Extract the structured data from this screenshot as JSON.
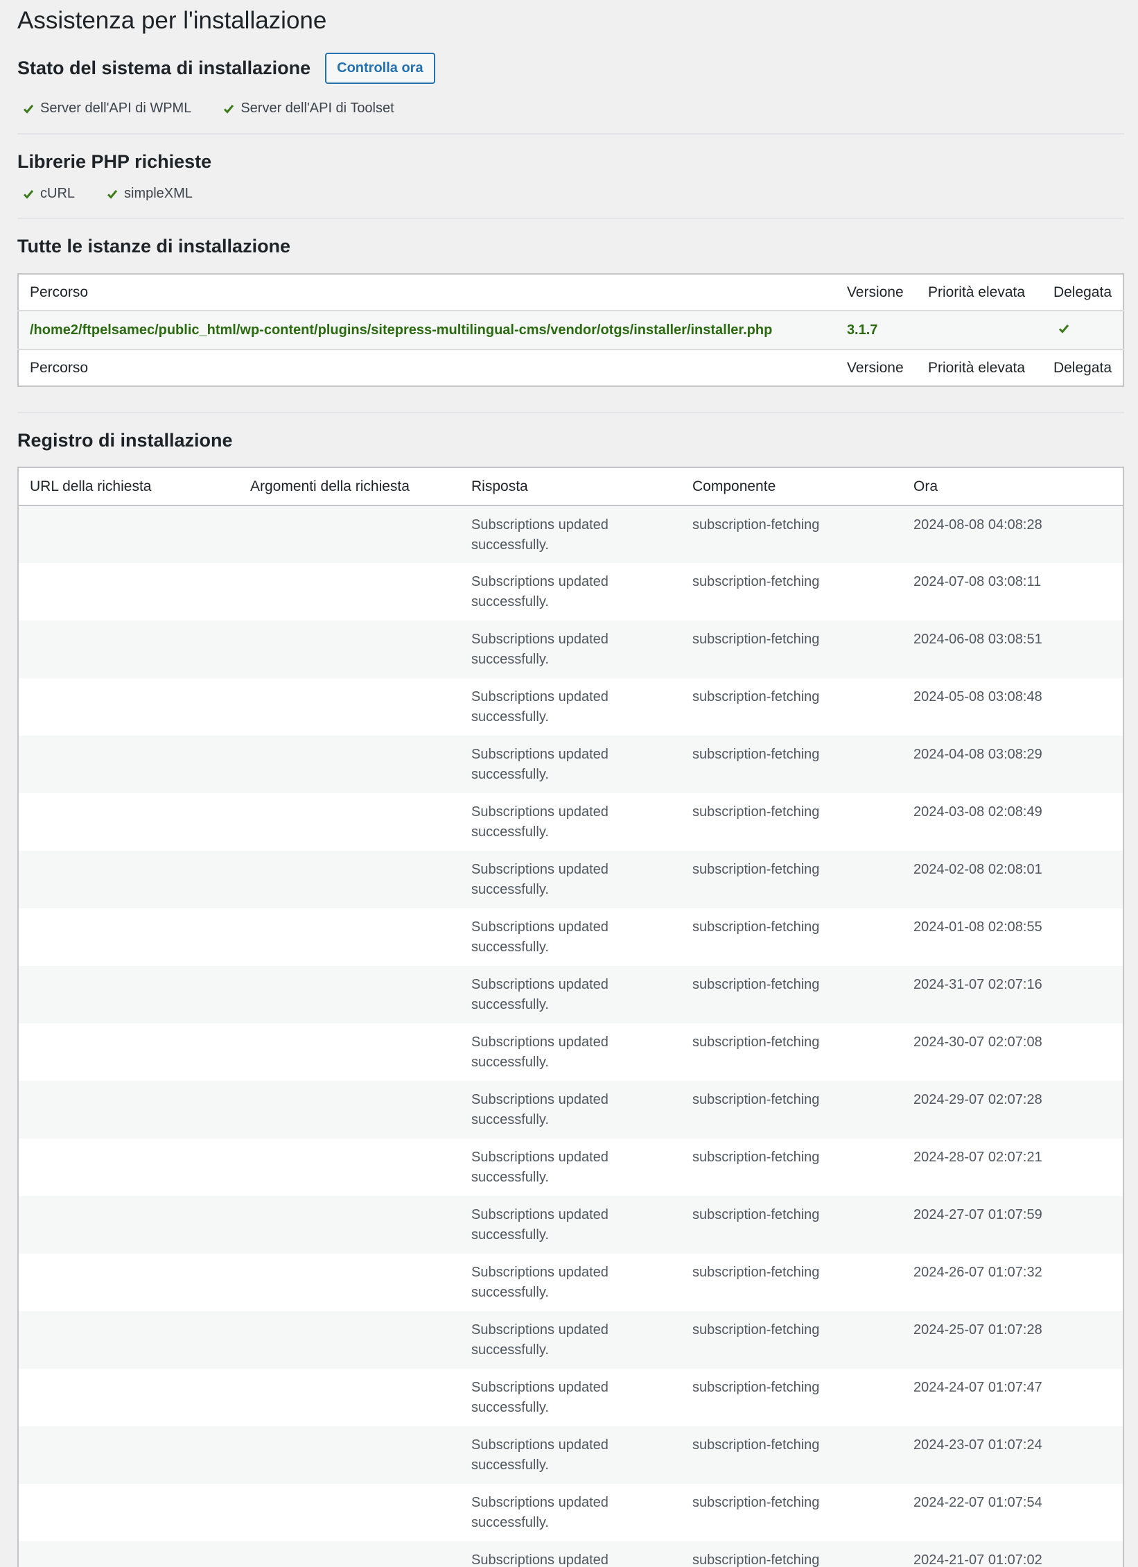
{
  "page_title": "Assistenza per l'installazione",
  "system_status": {
    "heading": "Stato del sistema di installazione",
    "check_button": "Controlla ora",
    "checks": [
      "Server dell'API di WPML",
      "Server dell'API di Toolset"
    ]
  },
  "php_libraries": {
    "heading": "Librerie PHP richieste",
    "items": [
      "cURL",
      "simpleXML"
    ]
  },
  "instances": {
    "heading": "Tutte le istanze di installazione",
    "columns": {
      "path": "Percorso",
      "version": "Versione",
      "priority": "Priorità elevata",
      "delegated": "Delegata"
    },
    "row": {
      "path": "/home2/ftpelsamec/public_html/wp-content/plugins/sitepress-multilingual-cms/vendor/otgs/installer/installer.php",
      "version": "3.1.7",
      "priority": "",
      "delegated_icon": "checkmark-icon"
    }
  },
  "log": {
    "heading": "Registro di installazione",
    "columns": {
      "url": "URL della richiesta",
      "args": "Argomenti della richiesta",
      "response": "Risposta",
      "component": "Componente",
      "time": "Ora"
    },
    "rows": [
      {
        "url": "",
        "args": "",
        "response": "Subscriptions updated successfully.",
        "component": "subscription-fetching",
        "time": "2024-08-08 04:08:28"
      },
      {
        "url": "",
        "args": "",
        "response": "Subscriptions updated successfully.",
        "component": "subscription-fetching",
        "time": "2024-07-08 03:08:11"
      },
      {
        "url": "",
        "args": "",
        "response": "Subscriptions updated successfully.",
        "component": "subscription-fetching",
        "time": "2024-06-08 03:08:51"
      },
      {
        "url": "",
        "args": "",
        "response": "Subscriptions updated successfully.",
        "component": "subscription-fetching",
        "time": "2024-05-08 03:08:48"
      },
      {
        "url": "",
        "args": "",
        "response": "Subscriptions updated successfully.",
        "component": "subscription-fetching",
        "time": "2024-04-08 03:08:29"
      },
      {
        "url": "",
        "args": "",
        "response": "Subscriptions updated successfully.",
        "component": "subscription-fetching",
        "time": "2024-03-08 02:08:49"
      },
      {
        "url": "",
        "args": "",
        "response": "Subscriptions updated successfully.",
        "component": "subscription-fetching",
        "time": "2024-02-08 02:08:01"
      },
      {
        "url": "",
        "args": "",
        "response": "Subscriptions updated successfully.",
        "component": "subscription-fetching",
        "time": "2024-01-08 02:08:55"
      },
      {
        "url": "",
        "args": "",
        "response": "Subscriptions updated successfully.",
        "component": "subscription-fetching",
        "time": "2024-31-07 02:07:16"
      },
      {
        "url": "",
        "args": "",
        "response": "Subscriptions updated successfully.",
        "component": "subscription-fetching",
        "time": "2024-30-07 02:07:08"
      },
      {
        "url": "",
        "args": "",
        "response": "Subscriptions updated successfully.",
        "component": "subscription-fetching",
        "time": "2024-29-07 02:07:28"
      },
      {
        "url": "",
        "args": "",
        "response": "Subscriptions updated successfully.",
        "component": "subscription-fetching",
        "time": "2024-28-07 02:07:21"
      },
      {
        "url": "",
        "args": "",
        "response": "Subscriptions updated successfully.",
        "component": "subscription-fetching",
        "time": "2024-27-07 01:07:59"
      },
      {
        "url": "",
        "args": "",
        "response": "Subscriptions updated successfully.",
        "component": "subscription-fetching",
        "time": "2024-26-07 01:07:32"
      },
      {
        "url": "",
        "args": "",
        "response": "Subscriptions updated successfully.",
        "component": "subscription-fetching",
        "time": "2024-25-07 01:07:28"
      },
      {
        "url": "",
        "args": "",
        "response": "Subscriptions updated successfully.",
        "component": "subscription-fetching",
        "time": "2024-24-07 01:07:47"
      },
      {
        "url": "",
        "args": "",
        "response": "Subscriptions updated successfully.",
        "component": "subscription-fetching",
        "time": "2024-23-07 01:07:24"
      },
      {
        "url": "",
        "args": "",
        "response": "Subscriptions updated successfully.",
        "component": "subscription-fetching",
        "time": "2024-22-07 01:07:54"
      },
      {
        "url": "",
        "args": "",
        "response": "Subscriptions updated successfully.",
        "component": "subscription-fetching",
        "time": "2024-21-07 01:07:02"
      }
    ]
  },
  "colors": {
    "accent": "#2271b1",
    "success": "#3d7a1a",
    "path_text": "#2b6b10"
  }
}
